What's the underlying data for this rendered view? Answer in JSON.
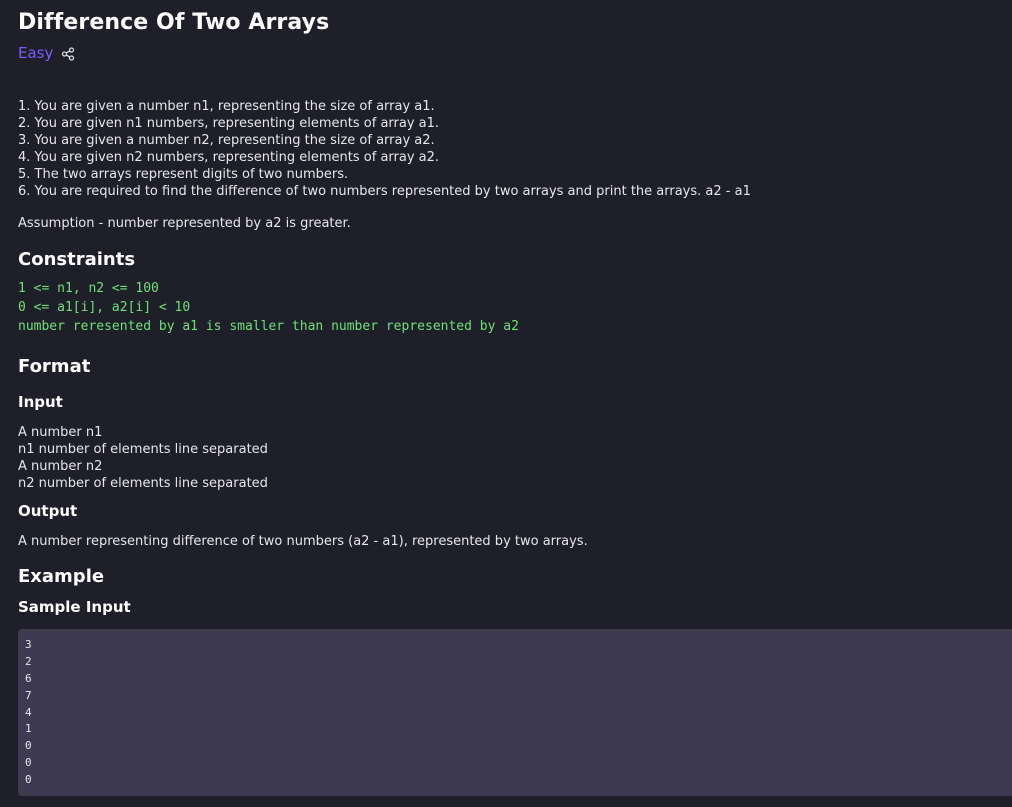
{
  "problem": {
    "title": "Difference Of Two Arrays",
    "difficulty": "Easy",
    "share_icon": "share-icon",
    "difficulty_color": "#7c5cff"
  },
  "description": {
    "lines": [
      "1. You are given a number n1, representing the size of array a1.",
      "2. You are given n1 numbers, representing elements of array a1.",
      "3. You are given a number n2, representing the size of array a2.",
      "4. You are given n2 numbers, representing elements of array a2.",
      "5. The two arrays represent digits of two numbers.",
      "6. You are required to find the difference of two numbers represented by two arrays and print the arrays. a2 - a1"
    ],
    "assumption": "Assumption - number represented by a2 is greater."
  },
  "constraints": {
    "heading": "Constraints",
    "lines": [
      "1 <= n1, n2 <= 100",
      "0 <= a1[i], a2[i] < 10",
      "number reresented by a1 is smaller than number represented by a2"
    ],
    "color": "#6ee07a"
  },
  "format": {
    "heading": "Format",
    "input_heading": "Input",
    "input_lines": [
      "A number n1",
      "n1 number of elements line separated",
      "A number n2",
      "n2 number of elements line separated"
    ],
    "output_heading": "Output",
    "output_text": "A number representing difference of two numbers (a2 - a1), represented by two arrays."
  },
  "example": {
    "heading": "Example",
    "sample_input_heading": "Sample Input",
    "sample_input_lines": [
      "3",
      "2",
      "6",
      "7",
      "4",
      "1",
      "0",
      "0",
      "0"
    ]
  }
}
